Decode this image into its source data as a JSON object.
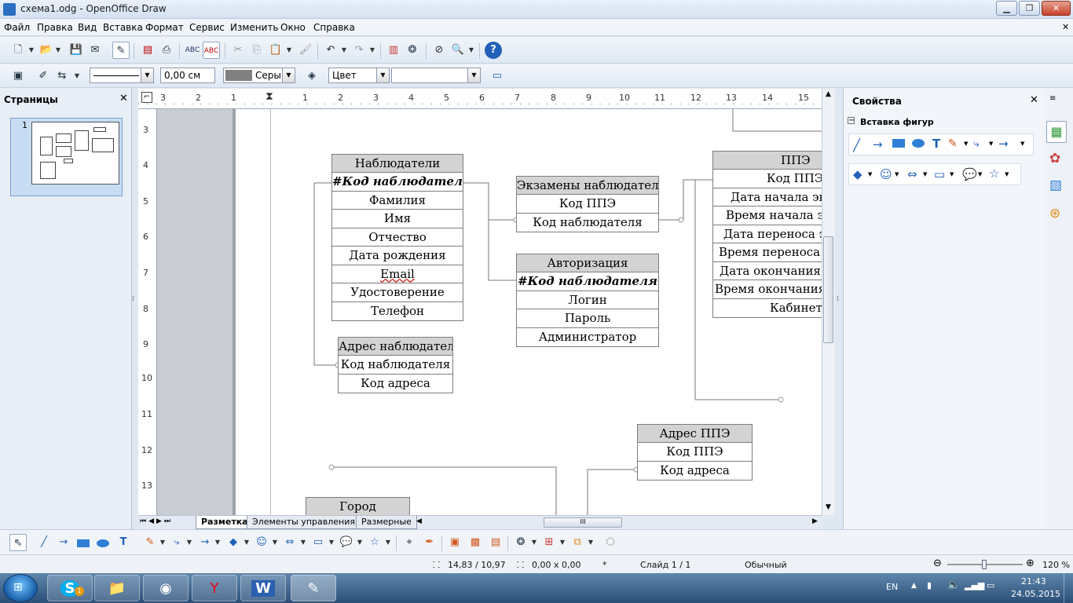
{
  "window": {
    "title": "схема1.odg - OpenOffice Draw"
  },
  "menu": [
    "Файл",
    "Правка",
    "Вид",
    "Вставка",
    "Формат",
    "Сервис",
    "Изменить",
    "Окно",
    "Справка"
  ],
  "line_toolbar": {
    "width_value": "0,00 см",
    "color_value": "Серый",
    "area_value": "Цвет",
    "area_extra": ""
  },
  "pages_panel": {
    "title": "Страницы",
    "page_number": "1"
  },
  "properties_panel": {
    "title": "Свойства",
    "section": "Вставка фигур"
  },
  "ruler_top": [
    "3",
    "2",
    "1",
    "1",
    "2",
    "3",
    "4",
    "5",
    "6",
    "7",
    "8",
    "9",
    "10",
    "11",
    "12",
    "13",
    "14",
    "15"
  ],
  "ruler_left": [
    "3",
    "4",
    "5",
    "6",
    "7",
    "8",
    "9",
    "10",
    "11",
    "12",
    "13"
  ],
  "tables": {
    "observers": {
      "title": "Наблюдатели",
      "rows": [
        "#Код наблюдателя",
        "Фамилия",
        "Имя",
        "Отчество",
        "Дата рождения",
        "Email",
        "Удостоверение",
        "Телефон"
      ]
    },
    "observer_exams": {
      "title": "Экзамены наблюдателя",
      "rows": [
        "Код ППЭ",
        "Код наблюдателя"
      ]
    },
    "authorization": {
      "title": "Авторизация",
      "rows": [
        "#Код наблюдателя",
        "Логин",
        "Пароль",
        "Администратор"
      ]
    },
    "ppe": {
      "title": "ППЭ",
      "rows": [
        "Код ППЭ",
        "Дата начала экз",
        "Время начала эк",
        "Дата переноса эк",
        "Время переноса э",
        "Дата окончания э",
        "Время окончания",
        "Кабинет"
      ]
    },
    "observer_address": {
      "title": "Адрес наблюдателя",
      "rows": [
        "Код наблюдателя",
        "Код адреса"
      ]
    },
    "ppe_address": {
      "title": "Адрес ППЭ",
      "rows": [
        "Код ППЭ",
        "Код адреса"
      ]
    },
    "city": {
      "title": "Город",
      "rows": []
    }
  },
  "tabs": [
    "Разметка",
    "Элементы управления",
    "Размерные"
  ],
  "status": {
    "position": "14,83 / 10,97",
    "size": "0,00 x 0,00",
    "modified": "*",
    "slide": "Слайд 1 / 1",
    "style": "Обычный",
    "zoom": "120 %"
  },
  "taskbar": {
    "lang": "EN",
    "time": "21:43",
    "date": "24.05.2015",
    "skype_badge": "1"
  },
  "colors": {
    "table_header": "#d3d3d3",
    "taskbar": "#3b6390",
    "canvas_margin": "#c9ccd1"
  }
}
